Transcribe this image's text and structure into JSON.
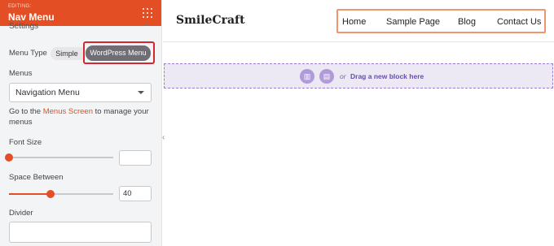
{
  "panel": {
    "editing_label": "EDITING:",
    "title": "Nav Menu",
    "section_label": "Settings",
    "menu_type": {
      "label": "Menu Type",
      "options": [
        "Simple",
        "WordPress Menu"
      ],
      "selected": "WordPress Menu"
    },
    "menus": {
      "label": "Menus",
      "selected": "Navigation Menu"
    },
    "help": {
      "prefix": "Go to the ",
      "link": "Menus Screen",
      "suffix": " to manage your menus"
    },
    "font_size": {
      "label": "Font Size",
      "value": "",
      "slider_fraction": 0
    },
    "space_between": {
      "label": "Space Between",
      "value": "40",
      "slider_fraction": 0.4
    },
    "divider": {
      "label": "Divider",
      "value": ""
    }
  },
  "site": {
    "logo": "SmileCraft",
    "nav": [
      "Home",
      "Sample Page",
      "Blog",
      "Contact Us"
    ]
  },
  "drop_zone": {
    "or": "or",
    "text": "Drag a new block here"
  },
  "colors": {
    "accent": "#e44e24",
    "highlight": "#d6262f",
    "nav_box": "#f0956d",
    "drop_zone": "#ece9f5",
    "drop_text": "#6a4bb0"
  }
}
